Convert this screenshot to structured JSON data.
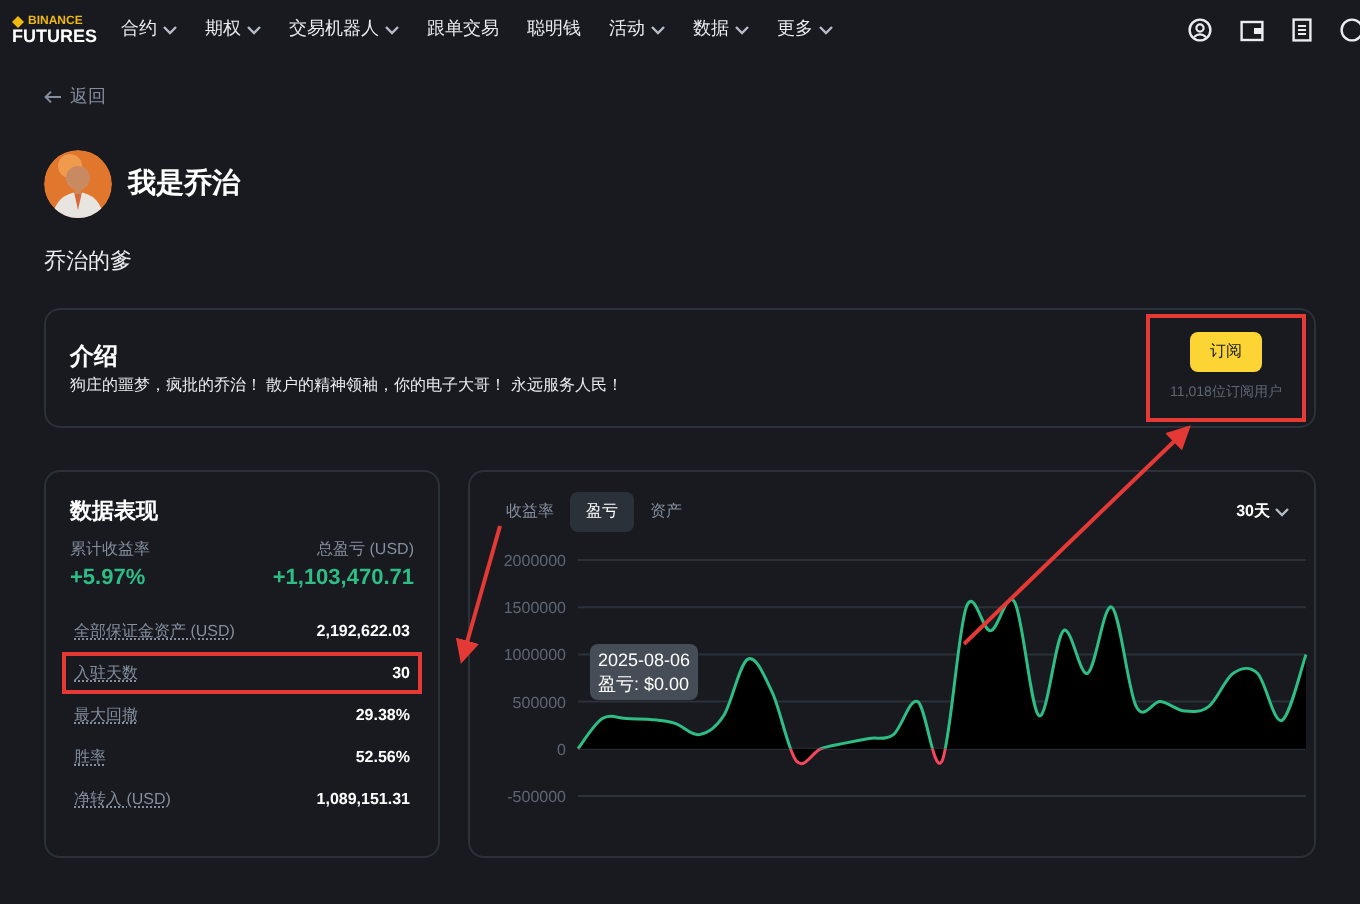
{
  "nav": {
    "logo_top": "BINANCE",
    "logo_bottom": "FUTURES",
    "items": [
      {
        "label": "合约",
        "has_menu": true
      },
      {
        "label": "期权",
        "has_menu": true
      },
      {
        "label": "交易机器人",
        "has_menu": true
      },
      {
        "label": "跟单交易",
        "has_menu": false
      },
      {
        "label": "聪明钱",
        "has_menu": false
      },
      {
        "label": "活动",
        "has_menu": true
      },
      {
        "label": "数据",
        "has_menu": true
      },
      {
        "label": "更多",
        "has_menu": true
      }
    ]
  },
  "back_link": "返回",
  "profile": {
    "name": "我是乔治",
    "bio": "乔治的爹"
  },
  "intro": {
    "title": "介绍",
    "text": "狗庄的噩梦，疯批的乔治！ 散户的精神领袖，你的电子大哥！ 永远服务人民！",
    "subscribe_button": "订阅",
    "subscribers": "11,018位订阅用户",
    "highlighted": true
  },
  "performance": {
    "title": "数据表现",
    "roi_label": "累计收益率",
    "roi_value": "+5.97%",
    "pnl_label": "总盈亏 (USD)",
    "pnl_value": "+1,103,470.71",
    "rows": [
      {
        "label": "全部保证金资产 (USD)",
        "value": "2,192,622.03",
        "highlighted": false
      },
      {
        "label": "入驻天数",
        "value": "30",
        "highlighted": true
      },
      {
        "label": "最大回撤",
        "value": "29.38%",
        "highlighted": false
      },
      {
        "label": "胜率",
        "value": "52.56%",
        "highlighted": false
      },
      {
        "label": "净转入 (USD)",
        "value": "1,089,151.31",
        "highlighted": false
      }
    ]
  },
  "chart_panel": {
    "tabs": [
      {
        "label": "收益率",
        "selected": false
      },
      {
        "label": "盈亏",
        "selected": true
      },
      {
        "label": "资产",
        "selected": false
      }
    ],
    "range": "30天",
    "tooltip": {
      "date": "2025-08-06",
      "text": "盈亏: $0.00"
    },
    "chart_data": {
      "type": "area",
      "grid": true,
      "ylim": [
        -500000,
        2000000
      ],
      "yticks": [
        -500000,
        0,
        500000,
        1000000,
        1500000,
        2000000
      ],
      "series": [
        {
          "color": "#2ebd85",
          "values": [
            0,
            320000,
            320000,
            310000,
            270000,
            150000,
            350000,
            950000,
            600000,
            -130000,
            0,
            60000,
            110000,
            150000,
            500000,
            -130000,
            1500000,
            1250000,
            1550000,
            350000,
            1250000,
            800000,
            1500000,
            450000,
            500000,
            400000,
            450000,
            800000,
            800000,
            300000,
            1000000
          ]
        }
      ]
    }
  }
}
